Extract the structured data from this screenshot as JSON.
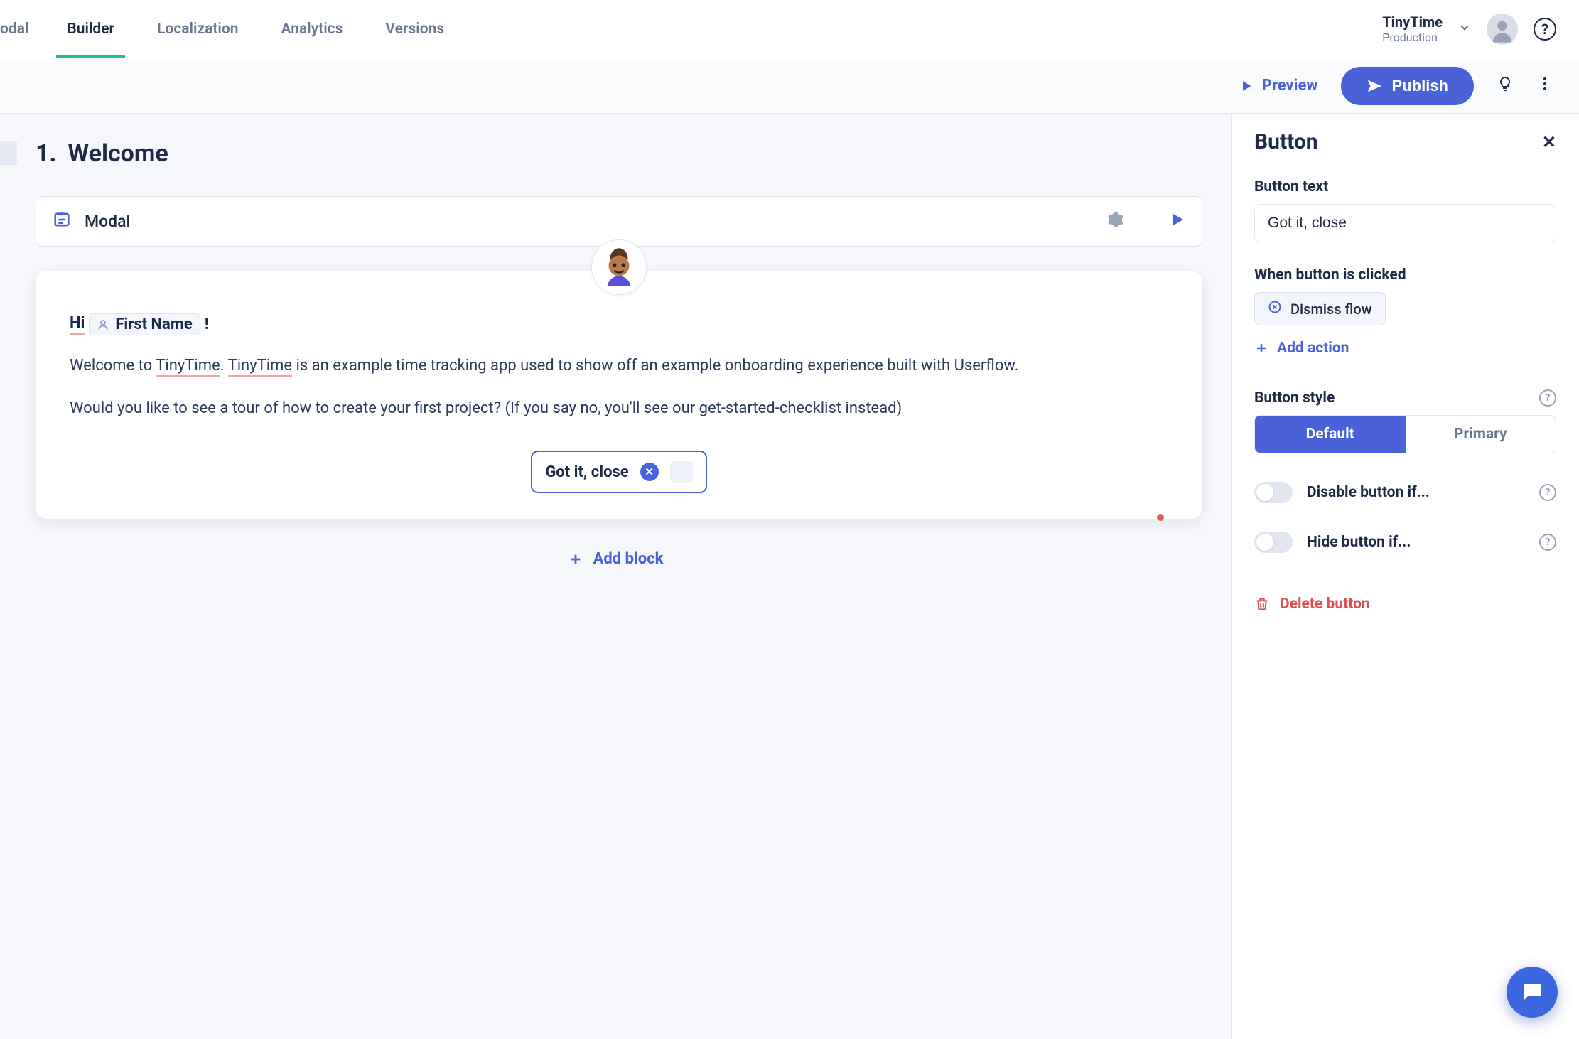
{
  "nav": {
    "tabs": [
      "odal",
      "Builder",
      "Localization",
      "Analytics",
      "Versions"
    ],
    "active_index": 1,
    "env": {
      "name": "TinyTime",
      "stage": "Production"
    }
  },
  "actionbar": {
    "preview": "Preview",
    "publish": "Publish"
  },
  "step": {
    "number": "1.",
    "title": "Welcome",
    "block_type": "Modal"
  },
  "modal_content": {
    "greet_prefix": "Hi",
    "name_token_label": "First Name",
    "greet_suffix": "!",
    "para1_a": "Welcome to ",
    "para1_link1": "TinyTime",
    "para1_b": ". ",
    "para1_link2": "TinyTime",
    "para1_c": " is an example time tracking app used to show off an example onboarding experience built with Userflow.",
    "para2": "Would you like to see a tour of how to create your first project? (If you say no, you'll see our get-started-checklist instead)",
    "cta_label": "Got it, close"
  },
  "add_block": "Add block",
  "panel": {
    "title": "Button",
    "fields": {
      "text_label": "Button text",
      "text_value": "Got it, close",
      "action_label": "When button is clicked",
      "action_chip": "Dismiss flow",
      "add_action": "Add action",
      "style_label": "Button style",
      "style_options": [
        "Default",
        "Primary"
      ],
      "style_selected": 0,
      "disable_label": "Disable button if...",
      "hide_label": "Hide button if...",
      "delete": "Delete button"
    }
  }
}
